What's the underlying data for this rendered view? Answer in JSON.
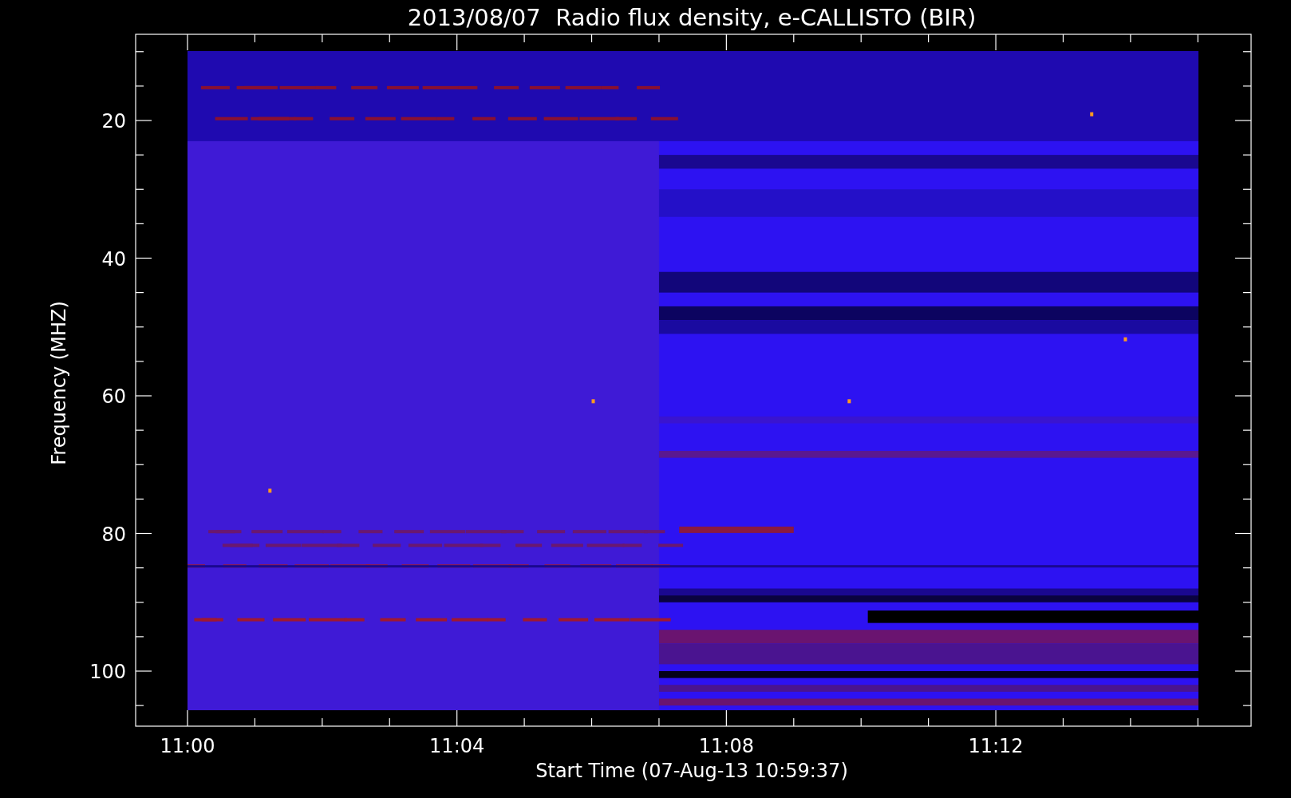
{
  "title": "2013/08/07  Radio flux density, e-CALLISTO (BIR)",
  "y_axis": {
    "label": "Frequency (MHZ)",
    "ticks": [
      "20",
      "40",
      "60",
      "80",
      "100"
    ]
  },
  "x_axis": {
    "label": "Start Time (07-Aug-13 10:59:37)",
    "ticks": [
      "11:00",
      "11:04",
      "11:08",
      "11:12"
    ]
  }
}
